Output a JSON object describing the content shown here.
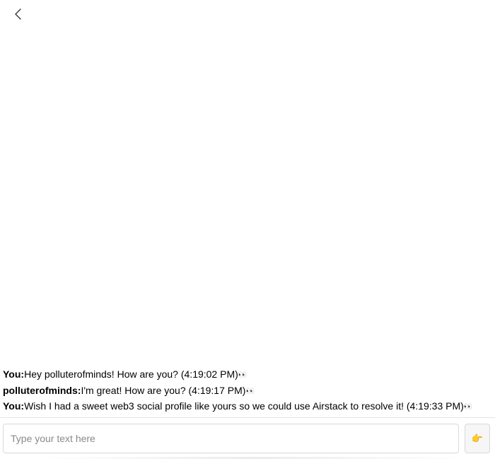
{
  "header": {
    "back_icon": "chevron-left-icon"
  },
  "messages": [
    {
      "sender": "You:",
      "text": "Hey polluterofminds! How are you? (4:19:02 PM)",
      "status": "👀"
    },
    {
      "sender": "polluterofminds:",
      "text": "I'm great! How are you? (4:19:17 PM)",
      "status": "👀"
    },
    {
      "sender": "You:",
      "text": "Wish I had a sweet web3 social profile like yours so we could use Airstack to resolve it! (4:19:33 PM)",
      "status": "👀"
    }
  ],
  "composer": {
    "placeholder": "Type your text here",
    "value": "",
    "send_icon": "👉",
    "send_icon_name": "pointing-hand-icon"
  },
  "colors": {
    "border": "#d9d9d9",
    "placeholder": "#8a8a8a",
    "send_bg": "#f6f6f6"
  }
}
